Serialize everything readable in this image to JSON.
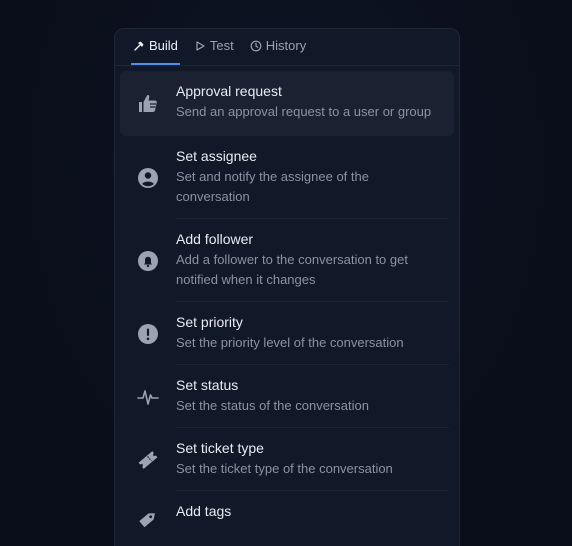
{
  "tabs": [
    {
      "label": "Build",
      "icon": "hammer-icon",
      "active": true
    },
    {
      "label": "Test",
      "icon": "play-icon",
      "active": false
    },
    {
      "label": "History",
      "icon": "clock-icon",
      "active": false
    }
  ],
  "items": [
    {
      "title": "Approval request",
      "desc": "Send an approval request to a user or group",
      "icon": "thumbs-up-icon"
    },
    {
      "title": "Set assignee",
      "desc": "Set and notify the assignee of the conversation",
      "icon": "user-circle-icon"
    },
    {
      "title": "Add follower",
      "desc": "Add a follower to the conversation to get notified when it changes",
      "icon": "bell-icon"
    },
    {
      "title": "Set priority",
      "desc": "Set the priority level of the conversation",
      "icon": "exclamation-circle-icon"
    },
    {
      "title": "Set status",
      "desc": "Set the status of the conversation",
      "icon": "pulse-icon"
    },
    {
      "title": "Set ticket type",
      "desc": "Set the ticket type of the conversation",
      "icon": "ticket-icon"
    },
    {
      "title": "Add tags",
      "desc": "",
      "icon": "tag-icon"
    }
  ],
  "colors": {
    "accent": "#4f8ef7",
    "panel": "#111827",
    "background": "#0a0f1c"
  }
}
